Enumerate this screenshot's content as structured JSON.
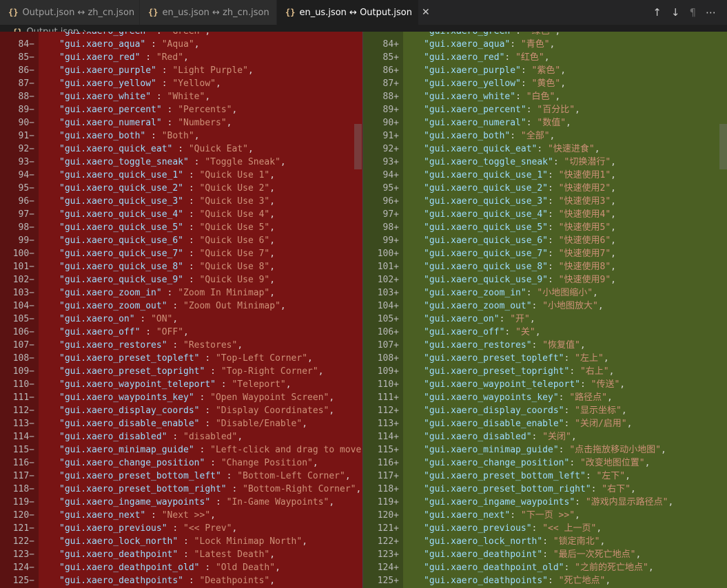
{
  "tabs": [
    {
      "label": "Output.json ↔ zh_cn.json",
      "icon": "json-braces-icon",
      "active": false
    },
    {
      "label": "en_us.json ↔ zh_cn.json",
      "icon": "json-braces-icon",
      "active": false
    },
    {
      "label": "en_us.json ↔ Output.json",
      "icon": "json-braces-icon",
      "active": true
    }
  ],
  "tab_actions": {
    "prev_change": "↑",
    "next_change": "↓",
    "whitespace": "¶"
  },
  "breadcrumb": {
    "file": "Output.json",
    "separator": "›",
    "more": "..."
  },
  "colors": {
    "removed": "#781414",
    "added": "#4b5f23",
    "key": "#9cdcfe",
    "string": "#ce9178"
  },
  "left": {
    "marker": "−",
    "top_partial": {
      "key": "\"gui.xaero_green\"",
      "value": "\"Green\""
    },
    "lines": [
      {
        "n": "84",
        "key": "\"gui.xaero_aqua\"",
        "value": "\"Aqua\""
      },
      {
        "n": "85",
        "key": "\"gui.xaero_red\"",
        "value": "\"Red\""
      },
      {
        "n": "86",
        "key": "\"gui.xaero_purple\"",
        "value": "\"Light Purple\""
      },
      {
        "n": "87",
        "key": "\"gui.xaero_yellow\"",
        "value": "\"Yellow\""
      },
      {
        "n": "88",
        "key": "\"gui.xaero_white\"",
        "value": "\"White\""
      },
      {
        "n": "89",
        "key": "\"gui.xaero_percent\"",
        "value": "\"Percents\""
      },
      {
        "n": "90",
        "key": "\"gui.xaero_numeral\"",
        "value": "\"Numbers\""
      },
      {
        "n": "91",
        "key": "\"gui.xaero_both\"",
        "value": "\"Both\""
      },
      {
        "n": "92",
        "key": "\"gui.xaero_quick_eat\"",
        "value": "\"Quick Eat\""
      },
      {
        "n": "93",
        "key": "\"gui.xaero_toggle_sneak\"",
        "value": "\"Toggle Sneak\""
      },
      {
        "n": "94",
        "key": "\"gui.xaero_quick_use_1\"",
        "value": "\"Quick Use 1\""
      },
      {
        "n": "95",
        "key": "\"gui.xaero_quick_use_2\"",
        "value": "\"Quick Use 2\""
      },
      {
        "n": "96",
        "key": "\"gui.xaero_quick_use_3\"",
        "value": "\"Quick Use 3\""
      },
      {
        "n": "97",
        "key": "\"gui.xaero_quick_use_4\"",
        "value": "\"Quick Use 4\""
      },
      {
        "n": "98",
        "key": "\"gui.xaero_quick_use_5\"",
        "value": "\"Quick Use 5\""
      },
      {
        "n": "99",
        "key": "\"gui.xaero_quick_use_6\"",
        "value": "\"Quick Use 6\""
      },
      {
        "n": "100",
        "key": "\"gui.xaero_quick_use_7\"",
        "value": "\"Quick Use 7\""
      },
      {
        "n": "101",
        "key": "\"gui.xaero_quick_use_8\"",
        "value": "\"Quick Use 8\""
      },
      {
        "n": "102",
        "key": "\"gui.xaero_quick_use_9\"",
        "value": "\"Quick Use 9\""
      },
      {
        "n": "103",
        "key": "\"gui.xaero_zoom_in\"",
        "value": "\"Zoom In Minimap\""
      },
      {
        "n": "104",
        "key": "\"gui.xaero_zoom_out\"",
        "value": "\"Zoom Out Minimap\""
      },
      {
        "n": "105",
        "key": "\"gui.xaero_on\"",
        "value": "\"ON\""
      },
      {
        "n": "106",
        "key": "\"gui.xaero_off\"",
        "value": "\"OFF\""
      },
      {
        "n": "107",
        "key": "\"gui.xaero_restores\"",
        "value": "\"Restores\""
      },
      {
        "n": "108",
        "key": "\"gui.xaero_preset_topleft\"",
        "value": "\"Top-Left Corner\""
      },
      {
        "n": "109",
        "key": "\"gui.xaero_preset_topright\"",
        "value": "\"Top-Right Corner\""
      },
      {
        "n": "110",
        "key": "\"gui.xaero_waypoint_teleport\"",
        "value": "\"Teleport\""
      },
      {
        "n": "111",
        "key": "\"gui.xaero_waypoints_key\"",
        "value": "\"Open Waypoint Screen\""
      },
      {
        "n": "112",
        "key": "\"gui.xaero_display_coords\"",
        "value": "\"Display Coordinates\""
      },
      {
        "n": "113",
        "key": "\"gui.xaero_disable_enable\"",
        "value": "\"Disable/Enable\""
      },
      {
        "n": "114",
        "key": "\"gui.xaero_disabled\"",
        "value": "\"disabled\""
      },
      {
        "n": "115",
        "key": "\"gui.xaero_minimap_guide\"",
        "value": "\"Left-click and drag to move"
      },
      {
        "n": "116",
        "key": "\"gui.xaero_change_position\"",
        "value": "\"Change Position\""
      },
      {
        "n": "117",
        "key": "\"gui.xaero_preset_bottom_left\"",
        "value": "\"Bottom-Left Corner\""
      },
      {
        "n": "118",
        "key": "\"gui.xaero_preset_bottom_right\"",
        "value": "\"Bottom-Right Corner\""
      },
      {
        "n": "119",
        "key": "\"gui.xaero_ingame_waypoints\"",
        "value": "\"In-Game Waypoints\""
      },
      {
        "n": "120",
        "key": "\"gui.xaero_next\"",
        "value": "\"Next >>\""
      },
      {
        "n": "121",
        "key": "\"gui.xaero_previous\"",
        "value": "\"<< Prev\""
      },
      {
        "n": "122",
        "key": "\"gui.xaero_lock_north\"",
        "value": "\"Lock Minimap North\""
      },
      {
        "n": "123",
        "key": "\"gui.xaero_deathpoint\"",
        "value": "\"Latest Death\""
      },
      {
        "n": "124",
        "key": "\"gui.xaero_deathpoint_old\"",
        "value": "\"Old Death\""
      },
      {
        "n": "125",
        "key": "\"gui.xaero_deathpoints\"",
        "value": "\"Deathpoints\""
      }
    ]
  },
  "right": {
    "marker": "+",
    "top_partial": {
      "key": "\"gui.xaero_green\"",
      "value": "\"绿色\""
    },
    "lines": [
      {
        "n": "84",
        "key": "\"gui.xaero_aqua\"",
        "value": "\"青色\""
      },
      {
        "n": "85",
        "key": "\"gui.xaero_red\"",
        "value": "\"红色\""
      },
      {
        "n": "86",
        "key": "\"gui.xaero_purple\"",
        "value": "\"紫色\""
      },
      {
        "n": "87",
        "key": "\"gui.xaero_yellow\"",
        "value": "\"黄色\""
      },
      {
        "n": "88",
        "key": "\"gui.xaero_white\"",
        "value": "\"白色\""
      },
      {
        "n": "89",
        "key": "\"gui.xaero_percent\"",
        "value": "\"百分比\""
      },
      {
        "n": "90",
        "key": "\"gui.xaero_numeral\"",
        "value": "\"数值\""
      },
      {
        "n": "91",
        "key": "\"gui.xaero_both\"",
        "value": "\"全部\""
      },
      {
        "n": "92",
        "key": "\"gui.xaero_quick_eat\"",
        "value": "\"快速进食\""
      },
      {
        "n": "93",
        "key": "\"gui.xaero_toggle_sneak\"",
        "value": "\"切换潜行\""
      },
      {
        "n": "94",
        "key": "\"gui.xaero_quick_use_1\"",
        "value": "\"快速使用1\""
      },
      {
        "n": "95",
        "key": "\"gui.xaero_quick_use_2\"",
        "value": "\"快速使用2\""
      },
      {
        "n": "96",
        "key": "\"gui.xaero_quick_use_3\"",
        "value": "\"快速使用3\""
      },
      {
        "n": "97",
        "key": "\"gui.xaero_quick_use_4\"",
        "value": "\"快速使用4\""
      },
      {
        "n": "98",
        "key": "\"gui.xaero_quick_use_5\"",
        "value": "\"快速使用5\""
      },
      {
        "n": "99",
        "key": "\"gui.xaero_quick_use_6\"",
        "value": "\"快速使用6\""
      },
      {
        "n": "100",
        "key": "\"gui.xaero_quick_use_7\"",
        "value": "\"快速使用7\""
      },
      {
        "n": "101",
        "key": "\"gui.xaero_quick_use_8\"",
        "value": "\"快速使用8\""
      },
      {
        "n": "102",
        "key": "\"gui.xaero_quick_use_9\"",
        "value": "\"快速使用9\""
      },
      {
        "n": "103",
        "key": "\"gui.xaero_zoom_in\"",
        "value": "\"小地图缩小\""
      },
      {
        "n": "104",
        "key": "\"gui.xaero_zoom_out\"",
        "value": "\"小地图放大\""
      },
      {
        "n": "105",
        "key": "\"gui.xaero_on\"",
        "value": "\"开\""
      },
      {
        "n": "106",
        "key": "\"gui.xaero_off\"",
        "value": "\"关\""
      },
      {
        "n": "107",
        "key": "\"gui.xaero_restores\"",
        "value": "\"恢复值\""
      },
      {
        "n": "108",
        "key": "\"gui.xaero_preset_topleft\"",
        "value": "\"左上\""
      },
      {
        "n": "109",
        "key": "\"gui.xaero_preset_topright\"",
        "value": "\"右上\""
      },
      {
        "n": "110",
        "key": "\"gui.xaero_waypoint_teleport\"",
        "value": "\"传送\""
      },
      {
        "n": "111",
        "key": "\"gui.xaero_waypoints_key\"",
        "value": "\"路径点\""
      },
      {
        "n": "112",
        "key": "\"gui.xaero_display_coords\"",
        "value": "\"显示坐标\""
      },
      {
        "n": "113",
        "key": "\"gui.xaero_disable_enable\"",
        "value": "\"关闭/启用\""
      },
      {
        "n": "114",
        "key": "\"gui.xaero_disabled\"",
        "value": "\"关闭\""
      },
      {
        "n": "115",
        "key": "\"gui.xaero_minimap_guide\"",
        "value": "\"点击拖放移动小地图\""
      },
      {
        "n": "116",
        "key": "\"gui.xaero_change_position\"",
        "value": "\"改变地图位置\""
      },
      {
        "n": "117",
        "key": "\"gui.xaero_preset_bottom_left\"",
        "value": "\"左下\""
      },
      {
        "n": "118",
        "key": "\"gui.xaero_preset_bottom_right\"",
        "value": "\"右下\""
      },
      {
        "n": "119",
        "key": "\"gui.xaero_ingame_waypoints\"",
        "value": "\"游戏内显示路径点\""
      },
      {
        "n": "120",
        "key": "\"gui.xaero_next\"",
        "value": "\"下一页 >>\""
      },
      {
        "n": "121",
        "key": "\"gui.xaero_previous\"",
        "value": "\"<< 上一页\""
      },
      {
        "n": "122",
        "key": "\"gui.xaero_lock_north\"",
        "value": "\"锁定南北\""
      },
      {
        "n": "123",
        "key": "\"gui.xaero_deathpoint\"",
        "value": "\"最后一次死亡地点\""
      },
      {
        "n": "124",
        "key": "\"gui.xaero_deathpoint_old\"",
        "value": "\"之前的死亡地点\""
      },
      {
        "n": "125",
        "key": "\"gui.xaero_deathpoints\"",
        "value": "\"死亡地点\""
      }
    ]
  }
}
